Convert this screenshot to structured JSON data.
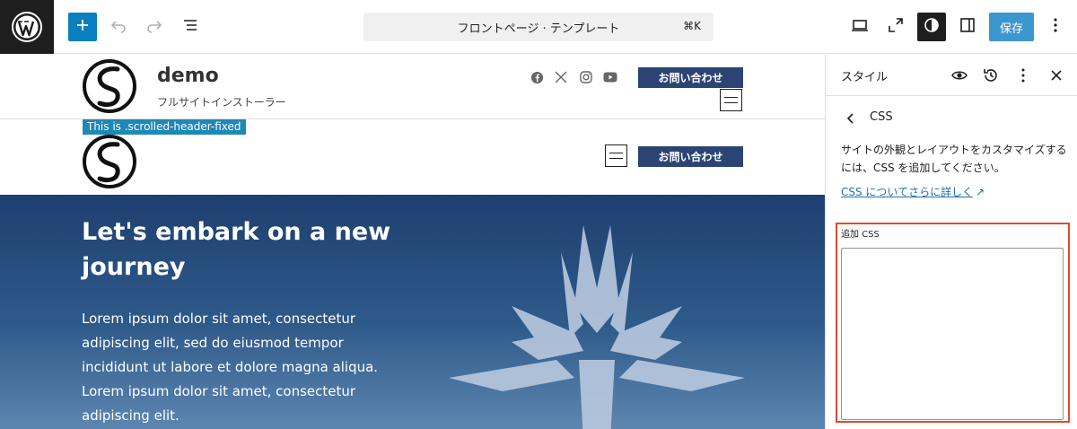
{
  "toolbar": {
    "add_label": "+",
    "command_title": "フロントページ · テンプレート",
    "command_shortcut": "⌘K",
    "save_label": "保存",
    "icons": [
      "wordpress-logo-icon",
      "plus-icon",
      "undo-icon",
      "redo-icon",
      "list-view-icon",
      "desktop-view-icon",
      "expand-icon",
      "styles-icon",
      "settings-sidebar-icon",
      "more-vertical-icon"
    ],
    "accent_color": "#0a7fbf"
  },
  "canvas": {
    "header": {
      "site_title": "demo",
      "tagline": "フルサイトインストーラー",
      "social_icons": [
        "facebook-icon",
        "x-twitter-icon",
        "instagram-icon",
        "youtube-icon"
      ],
      "contact_label": "お問い合わせ"
    },
    "fixed_label": "This is .scrolled-header-fixed",
    "header_fixed": {
      "contact_label": "お問い合わせ"
    },
    "hero": {
      "title": "Let's embark on a new journey",
      "text": "Lorem ipsum dolor sit amet, consectetur adipiscing elit, sed do eiusmod tempor incididunt ut labore et dolore magna aliqua. Lorem ipsum dolor sit amet, consectetur adipiscing elit."
    },
    "button_color": "#2b4474"
  },
  "sidebar": {
    "title": "スタイル",
    "section_title": "CSS",
    "description": "サイトの外観とレイアウトをカスタマイズするには、CSS を追加してください。",
    "link_label": "CSS についてさらに詳しく",
    "link_arrow": "↗",
    "additional_css_label": "追加 CSS",
    "additional_css_value": "",
    "highlight_color": "#e04b2c",
    "icons": [
      "eye-icon",
      "revisions-icon",
      "more-vertical-icon",
      "close-icon",
      "chevron-left-icon"
    ]
  }
}
